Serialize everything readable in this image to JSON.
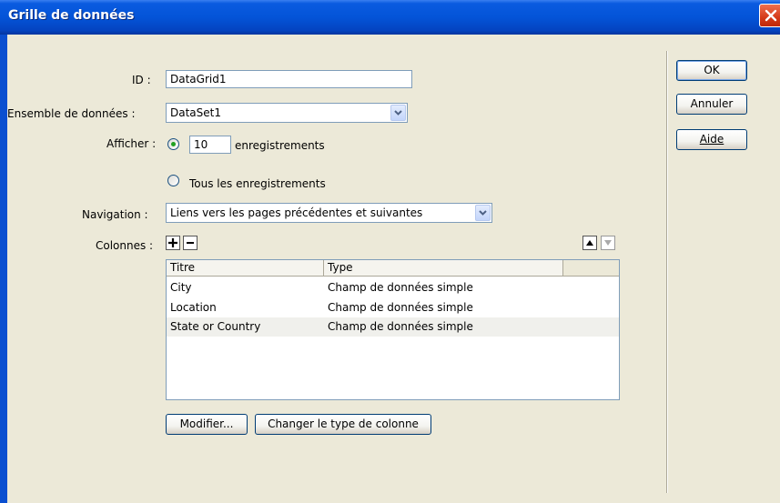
{
  "window": {
    "title": "Grille de données"
  },
  "form": {
    "id_label": "ID :",
    "id_value": "DataGrid1",
    "dataset_label": "Ensemble de données :",
    "dataset_value": "DataSet1",
    "show_label": "Afficher :",
    "records_count": "10",
    "records_suffix": "enregistrements",
    "all_records_label": "Tous les enregistrements",
    "navigation_label": "Navigation :",
    "navigation_value": "Liens vers les pages précédentes et suivantes",
    "columns_label": "Colonnes :"
  },
  "columns_table": {
    "headers": [
      "Titre",
      "Type"
    ],
    "rows": [
      {
        "title": "City",
        "type": "Champ de données simple"
      },
      {
        "title": "Location",
        "type": "Champ de données simple"
      },
      {
        "title": "State or Country",
        "type": "Champ de données simple"
      }
    ]
  },
  "buttons": {
    "ok": "OK",
    "cancel": "Annuler",
    "help": "Aide",
    "edit": "Modifier...",
    "change_type": "Changer le type de colonne"
  },
  "icons": {
    "close": "close-icon",
    "add": "plus-icon",
    "remove": "minus-icon",
    "up": "arrow-up-icon",
    "down": "arrow-down-icon",
    "dropdown": "chevron-down-icon"
  },
  "colors": {
    "titlebar": "#0454d8",
    "dialog_bg": "#ece9d8",
    "close_button": "#d43a18",
    "radio_selected": "#21a121"
  }
}
